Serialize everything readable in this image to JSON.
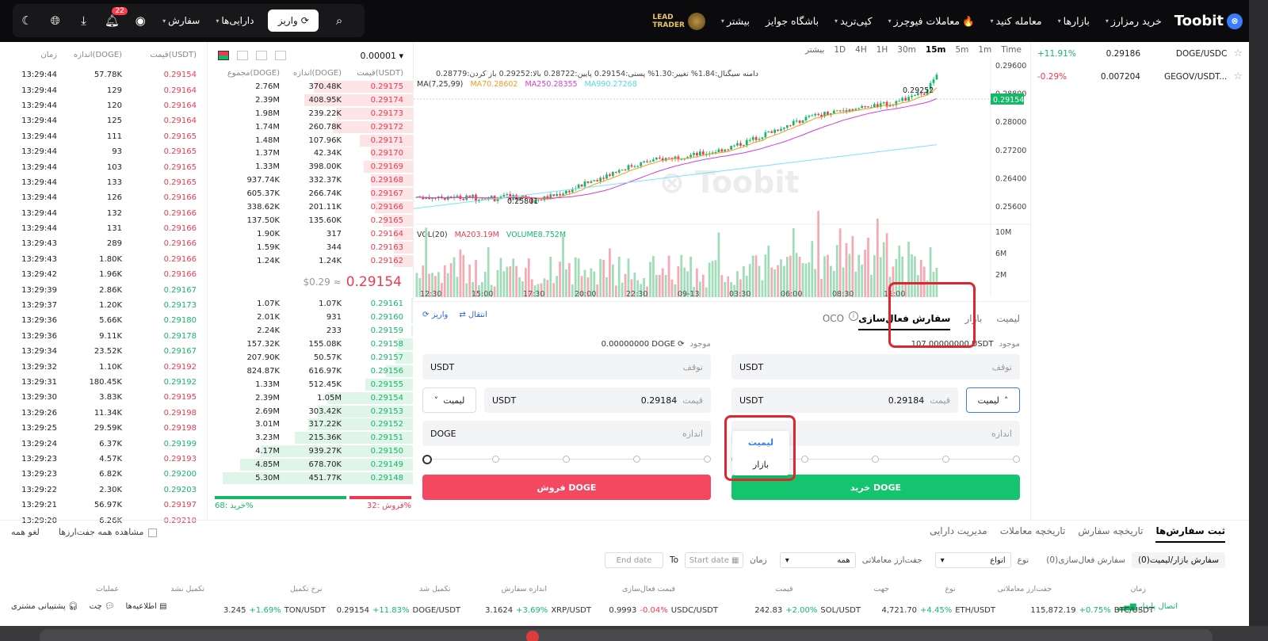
{
  "header": {
    "logo": "Toobit",
    "nav": [
      "خرید رمزارز",
      "بازارها",
      "معامله کنید",
      "معاملات فیوچرز",
      "کپی‌ترید",
      "باشگاه جوایز",
      "بیشتر"
    ],
    "lead_trader_1": "LEAD",
    "lead_trader_2": "TRADER",
    "orders": "سفارش",
    "assets": "دارایی‌ها",
    "deposit": "واریز",
    "notif_count": "22"
  },
  "trades": {
    "headers": [
      "قیمت(USDT)",
      "اندازه(DOGE)",
      "زمان"
    ],
    "rows": [
      {
        "p": "0.29154",
        "a": "57.78K",
        "t": "13:29:44",
        "s": "r"
      },
      {
        "p": "0.29164",
        "a": "129",
        "t": "13:29:44",
        "s": "r"
      },
      {
        "p": "0.29164",
        "a": "120",
        "t": "13:29:44",
        "s": "r"
      },
      {
        "p": "0.29164",
        "a": "125",
        "t": "13:29:44",
        "s": "r"
      },
      {
        "p": "0.29165",
        "a": "111",
        "t": "13:29:44",
        "s": "r"
      },
      {
        "p": "0.29165",
        "a": "93",
        "t": "13:29:44",
        "s": "r"
      },
      {
        "p": "0.29165",
        "a": "103",
        "t": "13:29:44",
        "s": "r"
      },
      {
        "p": "0.29165",
        "a": "133",
        "t": "13:29:44",
        "s": "r"
      },
      {
        "p": "0.29166",
        "a": "126",
        "t": "13:29:44",
        "s": "r"
      },
      {
        "p": "0.29166",
        "a": "132",
        "t": "13:29:44",
        "s": "r"
      },
      {
        "p": "0.29166",
        "a": "131",
        "t": "13:29:44",
        "s": "r"
      },
      {
        "p": "0.29166",
        "a": "289",
        "t": "13:29:43",
        "s": "r"
      },
      {
        "p": "0.29166",
        "a": "1.80K",
        "t": "13:29:43",
        "s": "r"
      },
      {
        "p": "0.29166",
        "a": "1.96K",
        "t": "13:29:42",
        "s": "r"
      },
      {
        "p": "0.29167",
        "a": "2.86K",
        "t": "13:29:39",
        "s": "g"
      },
      {
        "p": "0.29173",
        "a": "1.20K",
        "t": "13:29:37",
        "s": "g"
      },
      {
        "p": "0.29180",
        "a": "5.66K",
        "t": "13:29:36",
        "s": "g"
      },
      {
        "p": "0.29178",
        "a": "9.11K",
        "t": "13:29:36",
        "s": "g"
      },
      {
        "p": "0.29167",
        "a": "23.52K",
        "t": "13:29:34",
        "s": "g"
      },
      {
        "p": "0.29192",
        "a": "1.10K",
        "t": "13:29:32",
        "s": "r"
      },
      {
        "p": "0.29192",
        "a": "180.45K",
        "t": "13:29:31",
        "s": "g"
      },
      {
        "p": "0.29195",
        "a": "3.83K",
        "t": "13:29:30",
        "s": "r"
      },
      {
        "p": "0.29198",
        "a": "11.34K",
        "t": "13:29:26",
        "s": "r"
      },
      {
        "p": "0.29198",
        "a": "29.59K",
        "t": "13:29:25",
        "s": "r"
      },
      {
        "p": "0.29199",
        "a": "6.37K",
        "t": "13:29:24",
        "s": "g"
      },
      {
        "p": "0.29193",
        "a": "4.57K",
        "t": "13:29:23",
        "s": "r"
      },
      {
        "p": "0.29200",
        "a": "6.82K",
        "t": "13:29:23",
        "s": "g"
      },
      {
        "p": "0.29203",
        "a": "2.30K",
        "t": "13:29:22",
        "s": "g"
      },
      {
        "p": "0.29197",
        "a": "56.97K",
        "t": "13:29:21",
        "s": "r"
      },
      {
        "p": "0.29210",
        "a": "6.26K",
        "t": "13:29:20",
        "s": "r"
      }
    ]
  },
  "orderbook": {
    "precision": "0.00001",
    "headers": [
      "قیمت(USDT)",
      "اندازه(DOGE)",
      "مجموع(DOGE)"
    ],
    "asks": [
      {
        "p": "0.29175",
        "s": "370.48K",
        "t": "2.76M",
        "f": 52
      },
      {
        "p": "0.29174",
        "s": "408.95K",
        "t": "2.39M",
        "f": 57
      },
      {
        "p": "0.29173",
        "s": "239.22K",
        "t": "1.98M",
        "f": 40
      },
      {
        "p": "0.29172",
        "s": "260.78K",
        "t": "1.74M",
        "f": 42
      },
      {
        "p": "0.29171",
        "s": "107.96K",
        "t": "1.48M",
        "f": 28
      },
      {
        "p": "0.29170",
        "s": "42.34K",
        "t": "1.37M",
        "f": 22
      },
      {
        "p": "0.29169",
        "s": "398.00K",
        "t": "1.33M",
        "f": 26
      },
      {
        "p": "0.29168",
        "s": "332.37K",
        "t": "937.74K",
        "f": 22
      },
      {
        "p": "0.29167",
        "s": "266.74K",
        "t": "605.37K",
        "f": 22
      },
      {
        "p": "0.29166",
        "s": "201.11K",
        "t": "338.62K",
        "f": 20
      },
      {
        "p": "0.29165",
        "s": "135.60K",
        "t": "137.50K",
        "f": 16
      },
      {
        "p": "0.29164",
        "s": "317",
        "t": "1.90K",
        "f": 10
      },
      {
        "p": "0.29163",
        "s": "344",
        "t": "1.59K",
        "f": 10
      },
      {
        "p": "0.29162",
        "s": "1.24K",
        "t": "1.24K",
        "f": 10
      }
    ],
    "mid_price": "0.29154",
    "mid_usd": "$0.29 ≈",
    "bids": [
      {
        "p": "0.29161",
        "s": "1.07K",
        "t": "1.07K",
        "f": 1
      },
      {
        "p": "0.29160",
        "s": "931",
        "t": "2.01K",
        "f": 1
      },
      {
        "p": "0.29159",
        "s": "233",
        "t": "2.24K",
        "f": 1
      },
      {
        "p": "0.29158",
        "s": "155.08K",
        "t": "157.32K",
        "f": 8
      },
      {
        "p": "0.29157",
        "s": "50.57K",
        "t": "207.90K",
        "f": 9
      },
      {
        "p": "0.29156",
        "s": "616.97K",
        "t": "824.87K",
        "f": 14
      },
      {
        "p": "0.29155",
        "s": "512.45K",
        "t": "1.33M",
        "f": 25
      },
      {
        "p": "0.29154",
        "s": "1.05M",
        "t": "2.39M",
        "f": 45
      },
      {
        "p": "0.29153",
        "s": "303.42K",
        "t": "2.69M",
        "f": 50
      },
      {
        "p": "0.29152",
        "s": "317.22K",
        "t": "3.01M",
        "f": 55
      },
      {
        "p": "0.29151",
        "s": "215.36K",
        "t": "3.23M",
        "f": 62
      },
      {
        "p": "0.29150",
        "s": "939.27K",
        "t": "4.17M",
        "f": 80
      },
      {
        "p": "0.29149",
        "s": "678.70K",
        "t": "4.85M",
        "f": 91
      },
      {
        "p": "0.29148",
        "s": "451.77K",
        "t": "5.30M",
        "f": 100
      }
    ],
    "buy_pct_label": "خرید%",
    "buy_pct": "68",
    "sell_pct_label": "فروش%",
    "sell_pct": "32"
  },
  "chart": {
    "timeframes": [
      "Time",
      "1m",
      "5m",
      "15m",
      "30m",
      "1H",
      "4H",
      "1D",
      "بیشتر"
    ],
    "active_tf": "15m",
    "indicators": "دامنه سیگنال:1.84%    تغییر:1.30%    پستی:0.29154    پایین:0.28722    بالا:0.29252    باز کردن:0.28779",
    "ma": [
      "MA(7,25,99)",
      "MA70.28602",
      "MA250.28355",
      "MA990.27268"
    ],
    "vol": [
      "VOL(20)",
      "MA203.19M",
      "VOLUME8.752M"
    ],
    "y_labels": [
      "0.29600",
      "0.28800",
      "0.28000",
      "0.27200",
      "0.26400",
      "0.25600"
    ],
    "current_price": "0.29154",
    "hi_label": "0.29252",
    "lo_label": "0.25801",
    "vol_labels": [
      "10M",
      "6M",
      "2M"
    ],
    "x_labels": [
      "12:30",
      "15:00",
      "17:30",
      "20:00",
      "22:30",
      "09-13",
      "03:30",
      "06:00",
      "08:30",
      "11:00"
    ],
    "watermark": "Toobit"
  },
  "form": {
    "tabs": [
      "لیمیت",
      "بازار",
      "OCO",
      "سفارش فعال‌سازی"
    ],
    "active_tab": "سفارش فعال‌سازی",
    "transfer": "انتقال",
    "deposit": "واریز",
    "buy_balance_label": "موجود",
    "buy_balance": "107.00000000 USDT",
    "sell_balance_label": "موجود",
    "sell_balance": "0.00000000 DOGE",
    "stop_label": "توقف",
    "price_label": "قیمت",
    "size_label": "اندازه",
    "usdt": "USDT",
    "doge": "DOGE",
    "price_value": "0.29184",
    "limit": "لیمیت",
    "market": "بازار",
    "buy_btn": "خرید DOGE",
    "sell_btn": "فروش DOGE"
  },
  "watchlist": [
    {
      "pair": "DOGE/USDC",
      "price": "0.29186",
      "chg": "+11.91%",
      "s": "g"
    },
    {
      "pair": "GEGOV/USDT...",
      "price": "0.007204",
      "chg": "-0.29%",
      "s": "r"
    }
  ],
  "bottom": {
    "tabs": [
      "ثبت سفارش‌ها",
      "تاریخچه سفارش",
      "تاریخچه معاملات",
      "مدیریت دارایی"
    ],
    "cancel_all": "لغو همه",
    "view_all": "مشاهده همه جفت‌ارزها",
    "sub1": "سفارش بازار/لیمیت(0)",
    "sub2": "سفارش فعال‌سازی(0)",
    "type_label": "نوع",
    "type_value": "انواع",
    "pair_label": "جفت‌ارز معاملاتی",
    "pair_value": "همه",
    "time_label": "زمان",
    "start": "Start date",
    "to": "To",
    "end": "End date",
    "cols": [
      "زمان",
      "جفت‌ارز معاملاتی",
      "نوع",
      "جهت",
      "قیمت",
      "قیمت فعال‌سازی",
      "اندازه سفارش",
      "تکمیل شد",
      "نرخ تکمیل",
      "تکمیل نشد",
      "عملیات"
    ],
    "stable": "اتصال پایدار",
    "tickers": [
      {
        "pair": "BTC/USDT",
        "chg": "+0.75%",
        "price": "115,872.19",
        "s": "g"
      },
      {
        "pair": "ETH/USDT",
        "chg": "+4.45%",
        "price": "4,721.70",
        "s": "g"
      },
      {
        "pair": "SOL/USDT",
        "chg": "+2.00%",
        "price": "242.83",
        "s": "g"
      },
      {
        "pair": "USDC/USDT",
        "chg": "-0.04%",
        "price": "0.9993",
        "s": "r"
      },
      {
        "pair": "XRP/USDT",
        "chg": "+3.69%",
        "price": "3.1624",
        "s": "g"
      },
      {
        "pair": "DOGE/USDT",
        "chg": "+11.83%",
        "price": "0.29154",
        "s": "g"
      },
      {
        "pair": "TON/USDT",
        "chg": "+1.69%",
        "price": "3.245",
        "s": "g"
      }
    ],
    "support": "پشتیبانی مشتری",
    "chat": "چت",
    "notices": "اطلاعیه‌ها"
  },
  "colors": {
    "up": "#14b866",
    "down": "#f0394e",
    "accent": "#3b7bff",
    "highlight": "#e0262c"
  }
}
